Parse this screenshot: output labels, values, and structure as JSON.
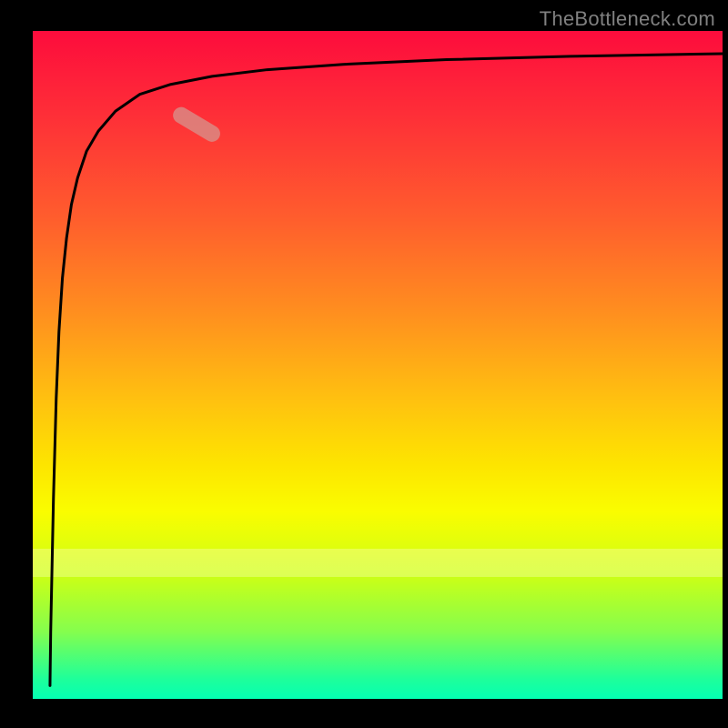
{
  "watermark": "TheBottleneck.com",
  "chart_data": {
    "type": "line",
    "title": "",
    "xlabel": "",
    "ylabel": "",
    "xlim": [
      0,
      100
    ],
    "ylim": [
      0,
      100
    ],
    "grid": false,
    "legend": false,
    "background": "gradient_red_to_green_vertical",
    "series": [
      {
        "name": "curve",
        "color": "#000000",
        "x": [
          2.5,
          2.6,
          3.0,
          3.4,
          3.8,
          4.3,
          4.9,
          5.6,
          6.5,
          7.8,
          9.5,
          12.0,
          15.5,
          20.0,
          26.0,
          34.0,
          45.0,
          60.0,
          78.0,
          100.0
        ],
        "values": [
          2.0,
          10.0,
          30.0,
          45.0,
          55.0,
          63.0,
          69.0,
          74.0,
          78.0,
          82.0,
          85.0,
          88.0,
          90.5,
          92.0,
          93.2,
          94.2,
          95.0,
          95.7,
          96.2,
          96.6
        ]
      }
    ],
    "marker": {
      "name": "highlight",
      "color": "#d6948d",
      "opacity": 0.75,
      "shape": "rounded_bar",
      "x_range": [
        20.5,
        27.0
      ],
      "y_range": [
        84.0,
        88.0
      ]
    }
  }
}
